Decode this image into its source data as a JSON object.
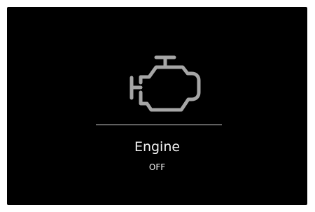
{
  "panel": {
    "icon": "engine-icon",
    "title": "Engine",
    "status": "OFF"
  },
  "colors": {
    "background": "#000000",
    "icon": "#a6a6a6",
    "text": "#f2f2f2",
    "divider": "#d9d9d9"
  }
}
